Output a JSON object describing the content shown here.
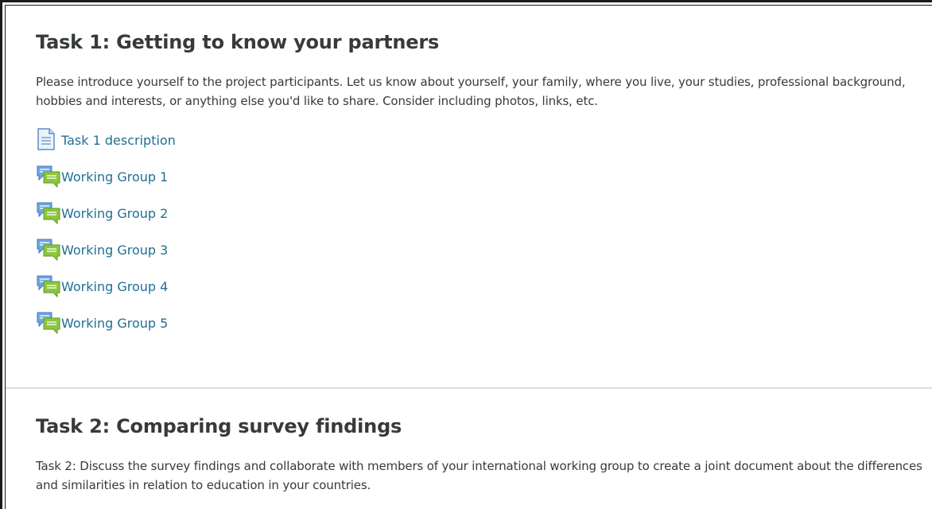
{
  "task1": {
    "title": "Task 1: Getting to know your partners",
    "summary": "Please introduce yourself to the project participants. Let us know about yourself, your family, where you live, your studies, professional background, hobbies and interests, or anything else you'd like to share. Consider including photos, links, etc.",
    "activities": [
      {
        "label": "Task 1 description",
        "icon": "page-icon"
      },
      {
        "label": "Working Group 1",
        "icon": "forum-icon"
      },
      {
        "label": "Working Group 2",
        "icon": "forum-icon"
      },
      {
        "label": "Working Group 3",
        "icon": "forum-icon"
      },
      {
        "label": "Working Group 4",
        "icon": "forum-icon"
      },
      {
        "label": "Working Group 5",
        "icon": "forum-icon"
      }
    ]
  },
  "task2": {
    "title": "Task 2: Comparing survey findings",
    "summary": "Task 2: Discuss the survey findings and collaborate with members of your international working group to create a joint document about the differences and similarities in relation to education in your countries."
  },
  "colors": {
    "link": "#1f6f94",
    "text": "#373a3c",
    "divider": "#dcdcdc",
    "forum_blue": "#6fa6e0",
    "forum_green": "#8cc63f"
  }
}
